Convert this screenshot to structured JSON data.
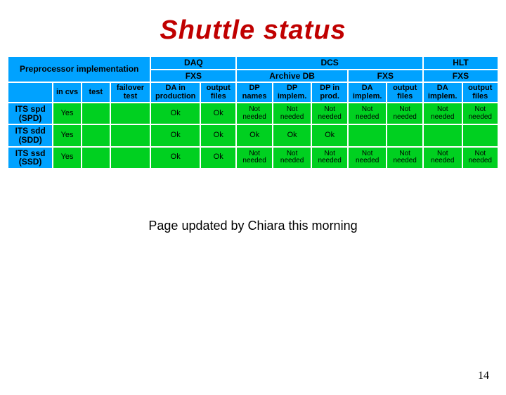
{
  "title": "Shuttle status",
  "caption": "Page updated by Chiara this morning",
  "page_number": "14",
  "top_groups": {
    "preproc": "Preprocessor implementation",
    "daq": "DAQ",
    "dcs": "DCS",
    "hlt": "HLT"
  },
  "mid_groups": {
    "daq_fxs": "FXS",
    "dcs_archive": "Archive DB",
    "dcs_fxs": "FXS",
    "hlt_fxs": "FXS"
  },
  "cols": {
    "c1": "in cvs",
    "c2": "test",
    "c3": "failover test",
    "c4": "DA in production",
    "c5": "output files",
    "c6": "DP names",
    "c7": "DP implem.",
    "c8": "DP in prod.",
    "c9": "DA implem.",
    "c10": "output files",
    "c11": "DA implem.",
    "c12": "output files"
  },
  "rows": [
    {
      "label": "ITS spd (SPD)",
      "cells": [
        "Yes",
        "",
        "",
        "Ok",
        "Ok",
        "Not needed",
        "Not needed",
        "Not needed",
        "Not needed",
        "Not needed",
        "Not needed",
        "Not needed"
      ]
    },
    {
      "label": "ITS sdd (SDD)",
      "cells": [
        "Yes",
        "",
        "",
        "Ok",
        "Ok",
        "Ok",
        "Ok",
        "Ok",
        "",
        "",
        "",
        ""
      ]
    },
    {
      "label": "ITS ssd (SSD)",
      "cells": [
        "Yes",
        "",
        "",
        "Ok",
        "Ok",
        "Not needed",
        "Not needed",
        "Not needed",
        "Not needed",
        "Not needed",
        "Not needed",
        "Not needed"
      ]
    }
  ]
}
